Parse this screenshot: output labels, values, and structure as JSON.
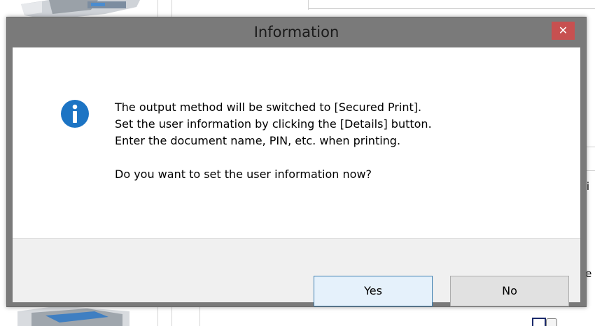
{
  "dialog": {
    "title": "Information",
    "close_icon": "close-icon",
    "close_glyph": "✕",
    "icon": "info-icon",
    "message_lines": [
      "The output method will be switched to [Secured Print].",
      "Set the user information by clicking the [Details] button.",
      "Enter the document name, PIN, etc. when printing."
    ],
    "question": "Do you want to set the user information now?",
    "buttons": {
      "yes": "Yes",
      "no": "No"
    }
  },
  "background": {
    "clipped_text_1": "ti",
    "clipped_text_2": "le"
  },
  "colors": {
    "title_bar": "#7a7a7a",
    "close_button": "#c75050",
    "info_icon": "#1c74c4",
    "default_button_border": "#3c7fb1",
    "default_button_fill": "#e5f1fb"
  }
}
